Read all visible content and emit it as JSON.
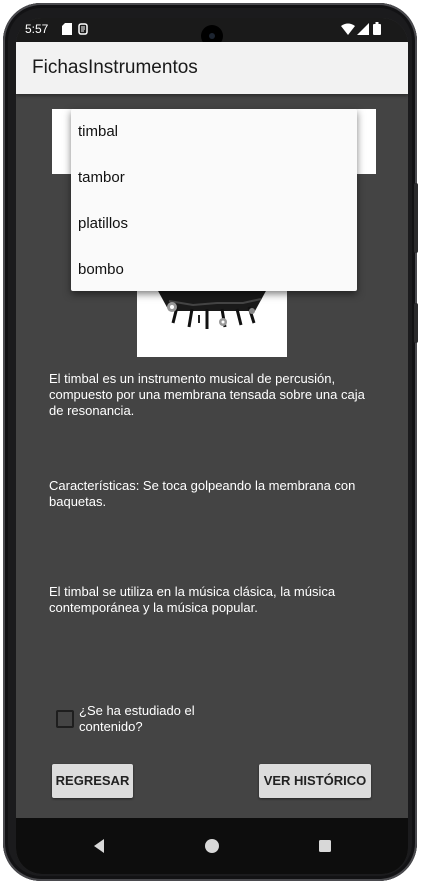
{
  "status_bar": {
    "time": "5:57",
    "icons": [
      "sd-card-icon",
      "app-notification-icon",
      "wifi-icon",
      "signal-icon",
      "battery-icon"
    ]
  },
  "app_bar": {
    "title": "FichasInstrumentos"
  },
  "spinner": {
    "options": [
      "timbal",
      "tambor",
      "platillos",
      "bombo"
    ]
  },
  "instrument": {
    "description": "El timbal es un instrumento musical de percusión, compuesto por una membrana tensada sobre una caja de resonancia.",
    "characteristics": "Características: Se toca golpeando la membrana con baquetas.",
    "usage": "El timbal se utiliza en la música clásica, la música contemporánea y la música popular."
  },
  "checkbox": {
    "label": "¿Se ha estudiado el contenido?",
    "checked": false
  },
  "buttons": {
    "back": "REGRESAR",
    "history": "VER HISTÓRICO"
  },
  "nav": [
    "back-icon",
    "home-icon",
    "recents-icon"
  ],
  "colors": {
    "background": "#444444",
    "app_bar": "#f2f2f2",
    "button": "#dcdcdc",
    "dropdown": "#fafafa"
  }
}
